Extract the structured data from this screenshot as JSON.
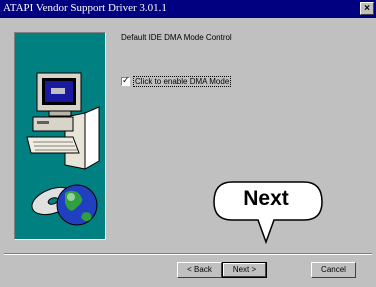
{
  "window": {
    "title": "ATAPI Vendor Support Driver 3.01.1",
    "close_glyph": "×"
  },
  "content": {
    "heading": "Default IDE DMA Mode Control",
    "checkbox_label": "Click to enable DMA Mode",
    "checkbox_checked": true,
    "check_glyph": "✓"
  },
  "buttons": {
    "back": "< Back",
    "next": "Next >",
    "cancel": "Cancel"
  },
  "callout": {
    "text": "Next"
  },
  "colors": {
    "titlebar": "#000080",
    "panel": "#008080",
    "face": "#c0c0c0"
  },
  "icons": [
    "computer-icon",
    "globe-cd-icon",
    "close-icon",
    "checkmark-icon"
  ]
}
